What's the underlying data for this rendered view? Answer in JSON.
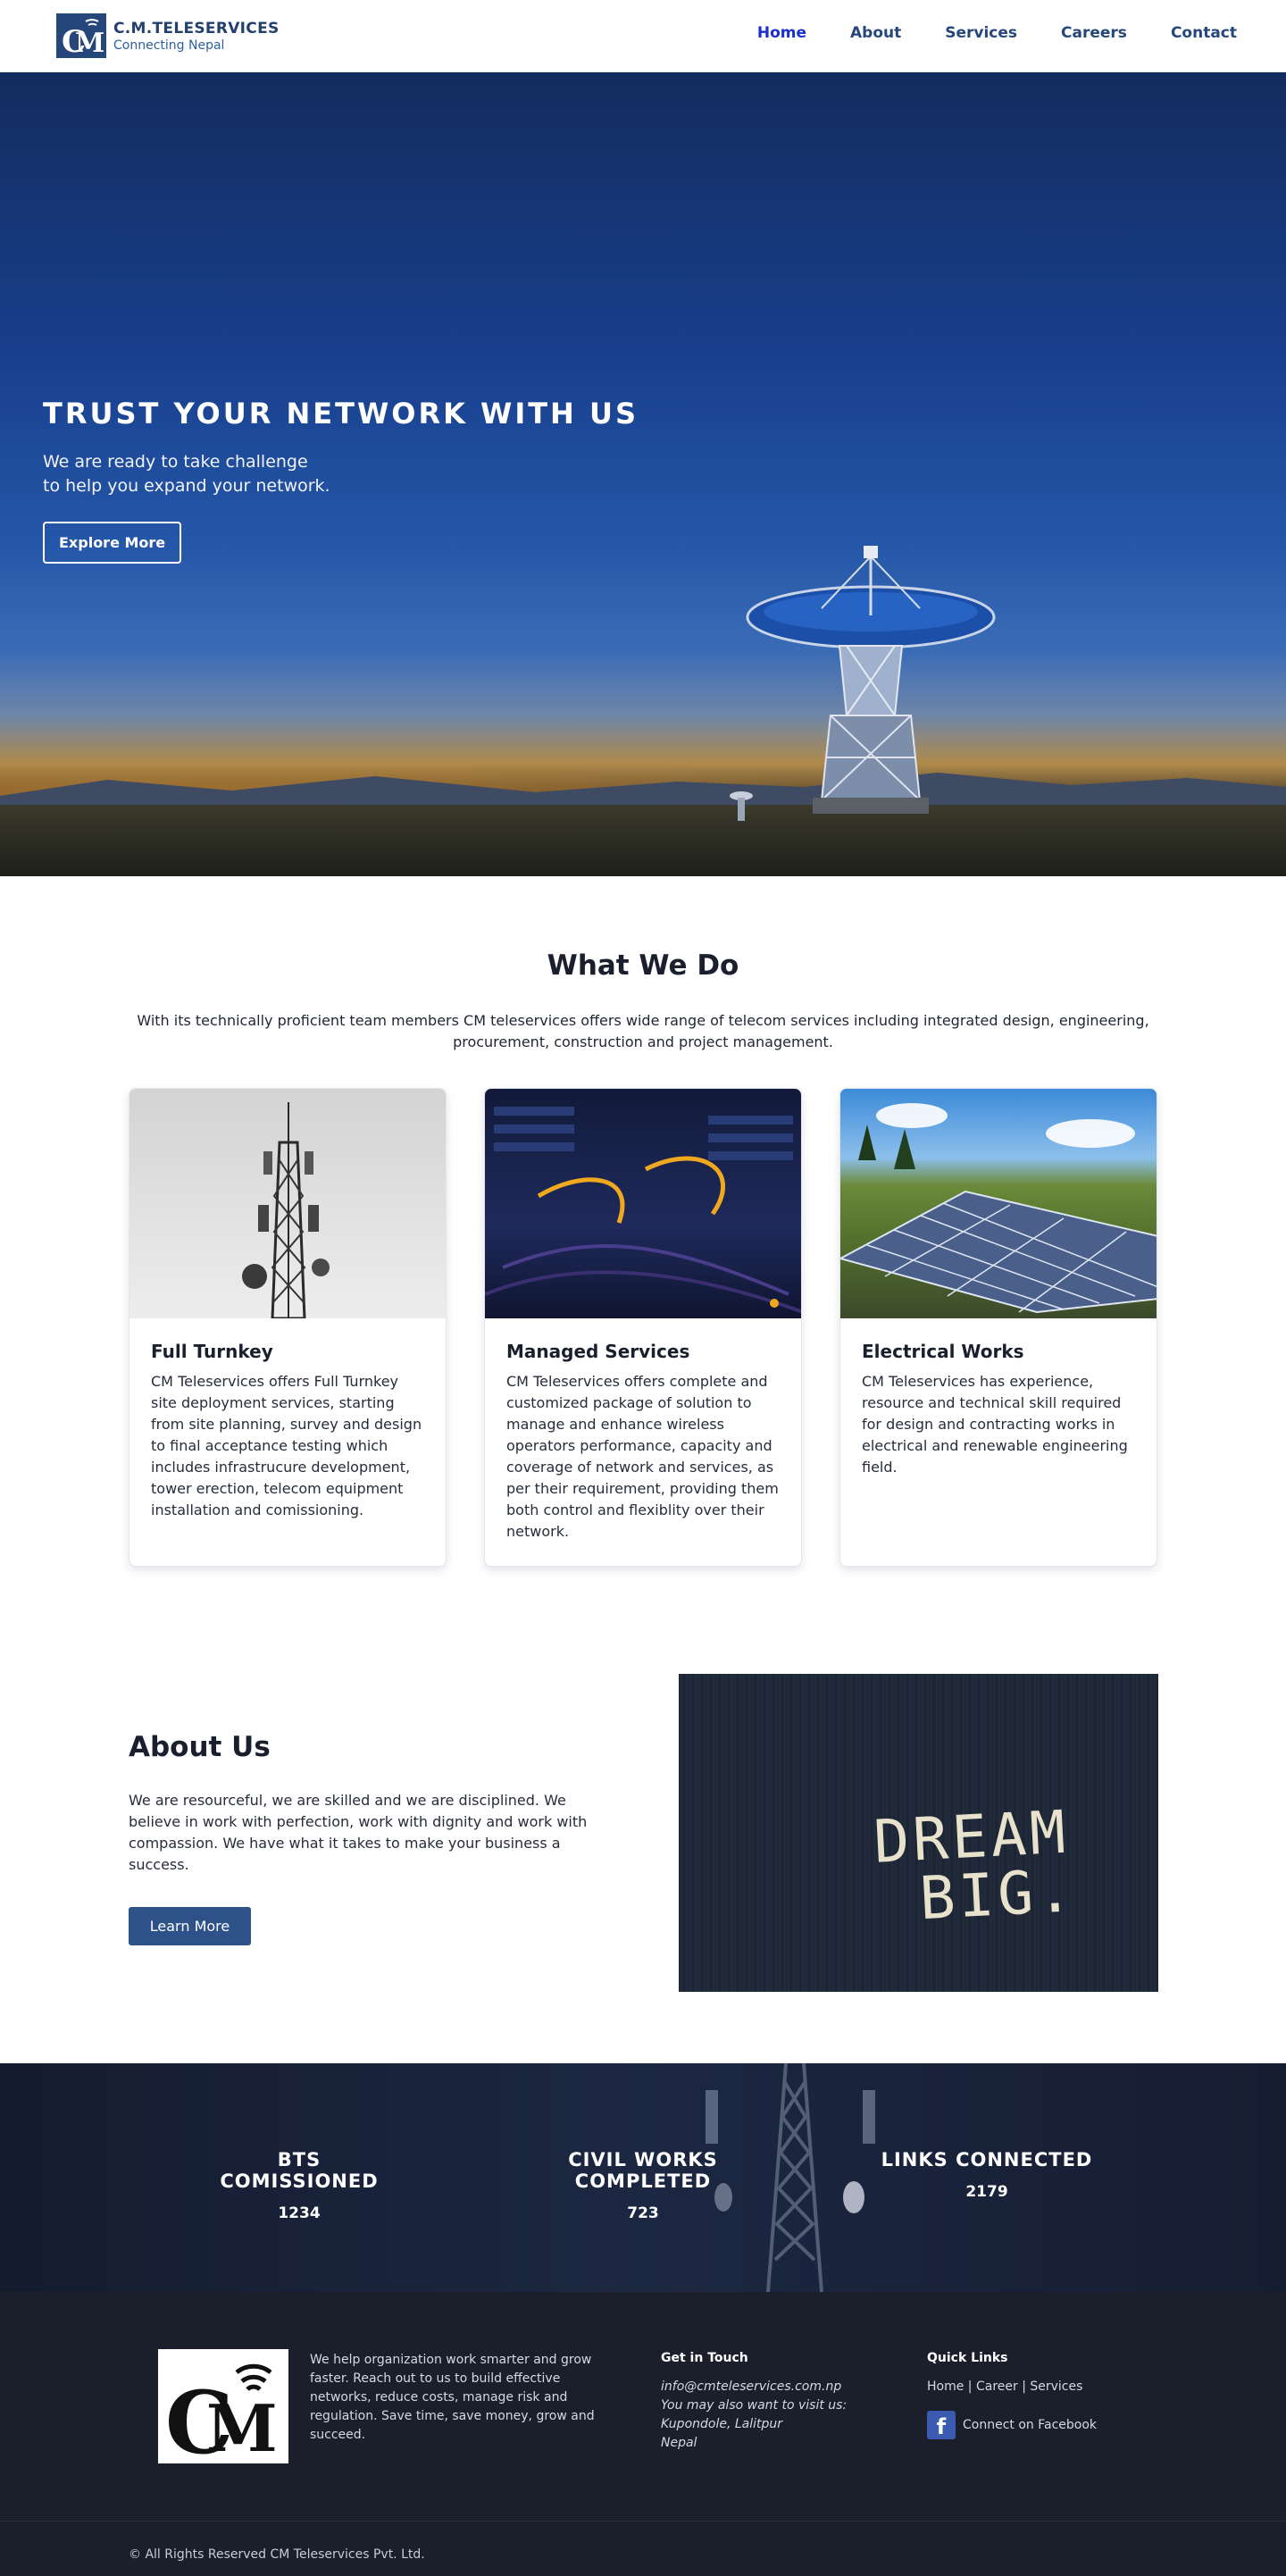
{
  "colors": {
    "brand": "#25477a",
    "nav_active": "#1a2fcf",
    "footer_bg": "#1b1f2b",
    "button": "#2e5189"
  },
  "header": {
    "brand_name": "C.M.TELESERVICES",
    "brand_tagline": "Connecting Nepal",
    "nav": [
      {
        "label": "Home",
        "active": true
      },
      {
        "label": "About",
        "active": false
      },
      {
        "label": "Services",
        "active": false
      },
      {
        "label": "Careers",
        "active": false
      },
      {
        "label": "Contact",
        "active": false
      }
    ]
  },
  "hero": {
    "title": "TRUST YOUR NETWORK WITH US",
    "subtitle": "We are ready to take challenge\nto help you expand your network.",
    "button": "Explore More"
  },
  "what_we_do": {
    "title": "What We Do",
    "description": "With its technically proficient team members CM teleservices offers wide range of telecom services including integrated design, engineering, procurement, construction and project management.",
    "cards": [
      {
        "title": "Full Turnkey",
        "text": "CM Teleservices offers Full Turnkey site deployment services, starting from site planning, survey and design to final acceptance testing which includes infrastrucure development, tower erection, telecom equipment installation and comissioning.",
        "image": "telecom-tower-image"
      },
      {
        "title": "Managed Services",
        "text": "CM Teleservices offers complete and customized package of solution to manage and enhance wireless operators performance, capacity and coverage of network and services, as per their requirement, providing them both control and flexiblity over their network.",
        "image": "fiber-cables-image"
      },
      {
        "title": "Electrical Works",
        "text": "CM Teleservices has experience, resource and technical skill required for design and contracting works in electrical and renewable engineering field.",
        "image": "solar-panels-image"
      }
    ]
  },
  "about": {
    "title": "About Us",
    "text": "We are resourceful, we are skilled and we are disciplined. We believe in work with perfection, work with dignity and work with compassion. We have what it takes to make your business a success.",
    "button": "Learn More",
    "image_text_1": "DREAM",
    "image_text_2": "BIG."
  },
  "stats": [
    {
      "label": "BTS COMISSIONED",
      "value": "1234"
    },
    {
      "label": "CIVIL WORKS COMPLETED",
      "value": "723"
    },
    {
      "label": "LINKS CONNECTED",
      "value": "2179"
    }
  ],
  "footer": {
    "about": "We help organization work smarter and grow faster. Reach out to us to build effective networks, reduce costs, manage risk and regulation. Save time, save money, grow and succeed.",
    "contact_heading": "Get in Touch",
    "email": "info@cmteleservices.com.np",
    "visit_text": "You may also want to visit us:",
    "address_1": "Kupondole, Lalitpur",
    "address_2": "Nepal",
    "links_heading": "Quick Links",
    "links": "Home | Career | Services",
    "facebook_label": "Connect on Facebook",
    "facebook_icon": "f",
    "copyright": "© All Rights Reserved CM Teleservices Pvt. Ltd."
  }
}
